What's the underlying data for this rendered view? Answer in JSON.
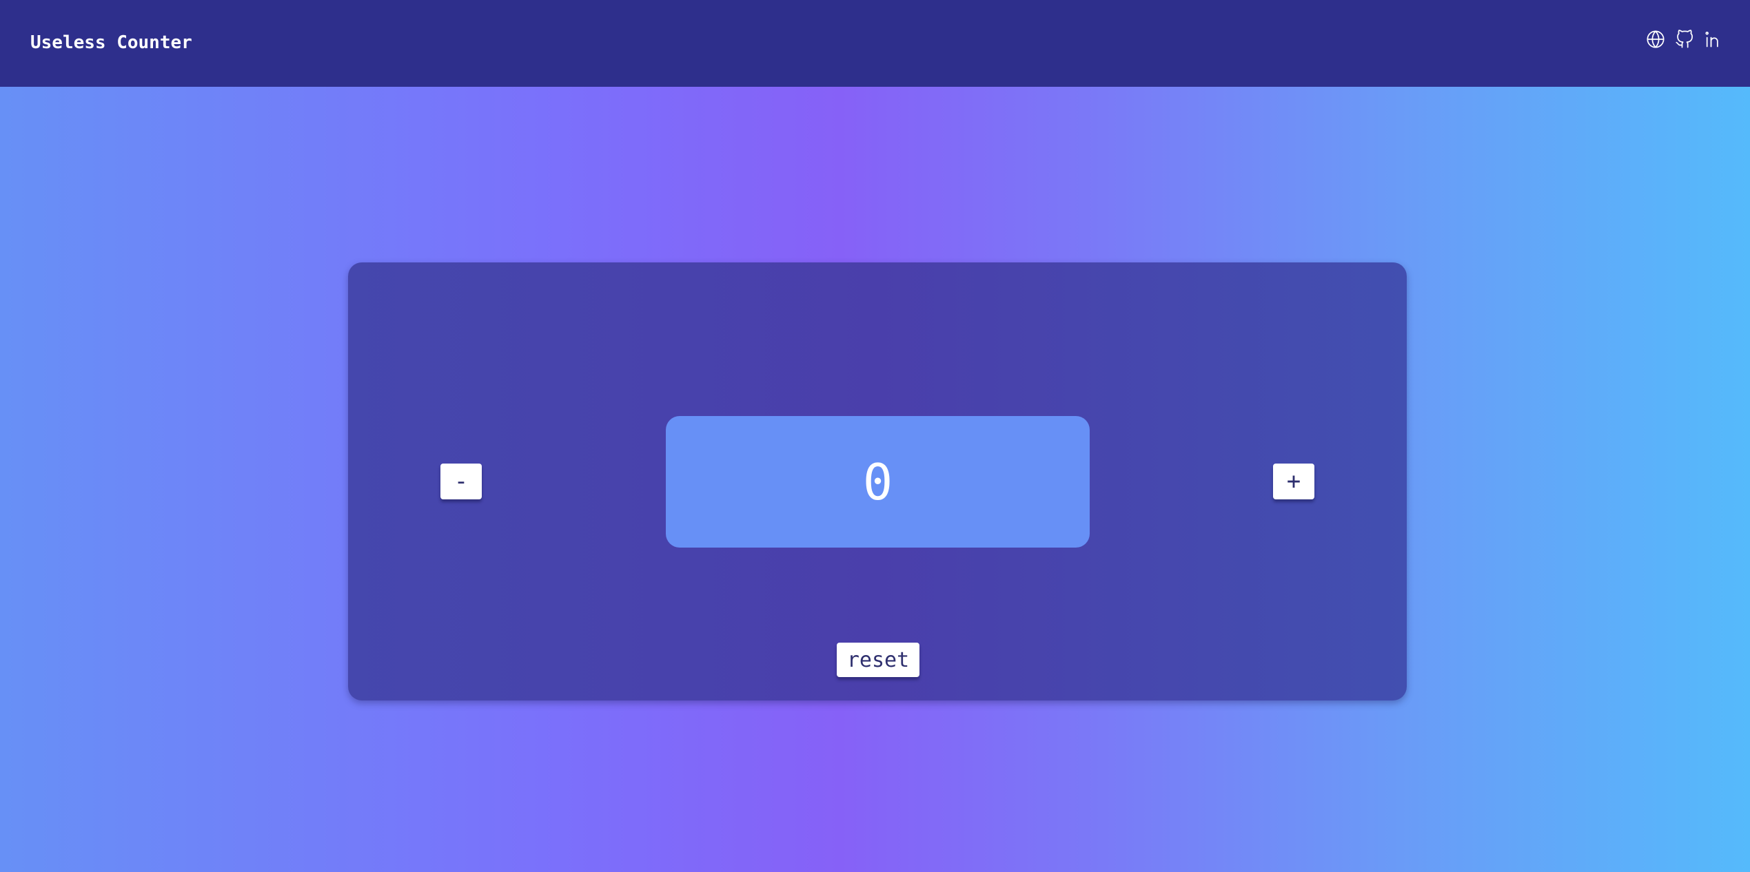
{
  "header": {
    "title": "Useless Counter",
    "icons": [
      "globe-icon",
      "github-icon",
      "linkedin-icon"
    ]
  },
  "counter": {
    "value": "0",
    "decrement_label": "-",
    "increment_label": "+",
    "reset_label": "reset"
  },
  "colors": {
    "topbar": "#2e2f8c",
    "card": "#4547ad",
    "display": "#6790f6",
    "button": "#ffffff",
    "background_left": "#6790f6",
    "background_center": "#8661f7",
    "background_right": "#55bafb"
  }
}
